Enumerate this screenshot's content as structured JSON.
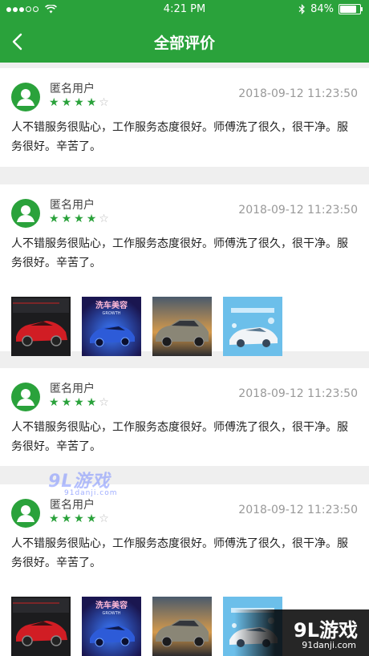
{
  "status_bar": {
    "time": "4:21 PM",
    "battery": "84%",
    "battery_level": 0.84
  },
  "nav": {
    "back_icon": "chevron-left-icon",
    "title": "全部评价"
  },
  "reviews": [
    {
      "user": "匿名用户",
      "rating": 4,
      "max_rating": 5,
      "date": "2018-09-12 11:23:50",
      "comment": "人不错服务很贴心，工作服务态度很好。师傅洗了很久，很干净。服务很好。辛苦了。",
      "photos": []
    },
    {
      "user": "匿名用户",
      "rating": 4,
      "max_rating": 5,
      "date": "2018-09-12 11:23:50",
      "comment": "人不错服务很贴心，工作服务态度很好。师傅洗了很久，很干净。服务很好。辛苦了。",
      "photos": [
        "red-sports-car",
        "blue-car-poster",
        "bronze-sedan",
        "car-wash-ad"
      ]
    },
    {
      "user": "匿名用户",
      "rating": 4,
      "max_rating": 5,
      "date": "2018-09-12 11:23:50",
      "comment": "人不错服务很贴心，工作服务态度很好。师傅洗了很久，很干净。服务很好。辛苦了。",
      "photos": []
    },
    {
      "user": "匿名用户",
      "rating": 4,
      "max_rating": 5,
      "date": "2018-09-12 11:23:50",
      "comment": "人不错服务很贴心，工作服务态度很好。师傅洗了很久，很干净。服务很好。辛苦了。",
      "photos": [
        "red-sports-car",
        "blue-car-poster",
        "bronze-sedan",
        "car-wash-ad"
      ]
    }
  ],
  "photo_text": {
    "poster_title": "洗车美容",
    "poster_sub": "GROWTH"
  },
  "watermark": {
    "mid_logo": "9L游戏",
    "mid_url": "91danji.com",
    "corner_logo": "9L游戏",
    "corner_url": "91danji.com"
  },
  "colors": {
    "brand_green": "#2aa23b",
    "text_gray": "#999999"
  }
}
